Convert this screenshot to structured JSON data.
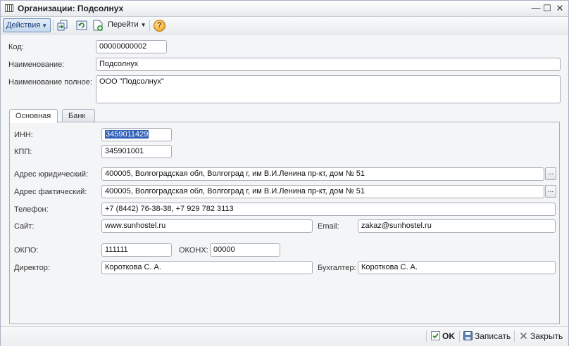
{
  "window": {
    "title": "Организации: Подсолнух"
  },
  "toolbar": {
    "actions_label": "Действия",
    "goto_label": "Перейти",
    "help_label": "?"
  },
  "form": {
    "code_label": "Код:",
    "code_value": "00000000002",
    "name_label": "Наименование:",
    "name_value": "Подсолнух",
    "fullname_label": "Наименование полное:",
    "fullname_value": "ООО \"Подсолнух\""
  },
  "tabs": [
    {
      "label": "Основная"
    },
    {
      "label": "Банк"
    }
  ],
  "main": {
    "inn_label": "ИНН:",
    "inn_value": "3459011429",
    "kpp_label": "КПП:",
    "kpp_value": "345901001",
    "legal_address_label": "Адрес юридический:",
    "legal_address_value": "400005, Волгоградская обл, Волгоград г, им В.И.Ленина пр-кт, дом № 51",
    "actual_address_label": "Адрес фактический:",
    "actual_address_value": "400005, Волгоградская обл, Волгоград г, им В.И.Ленина пр-кт, дом № 51",
    "phone_label": "Телефон:",
    "phone_value": "+7 (8442) 76-38-38, +7 929 782 3113",
    "site_label": "Сайт:",
    "site_value": "www.sunhostel.ru",
    "email_label": "Email:",
    "email_value": "zakaz@sunhostel.ru",
    "okpo_label": "ОКПО:",
    "okpo_value": "111111",
    "okonh_label": "ОКОНХ:",
    "okonh_value": "00000",
    "director_label": "Директор:",
    "director_value": "Короткова С. А.",
    "accountant_label": "Бухгалтер:",
    "accountant_value": "Короткова С. А.",
    "ellipsis": "..."
  },
  "footer": {
    "ok_label": "OK",
    "save_label": "Записать",
    "close_label": "Закрыть"
  },
  "colors": {
    "selection": "#3060b8",
    "accent": "#1a3c78"
  }
}
